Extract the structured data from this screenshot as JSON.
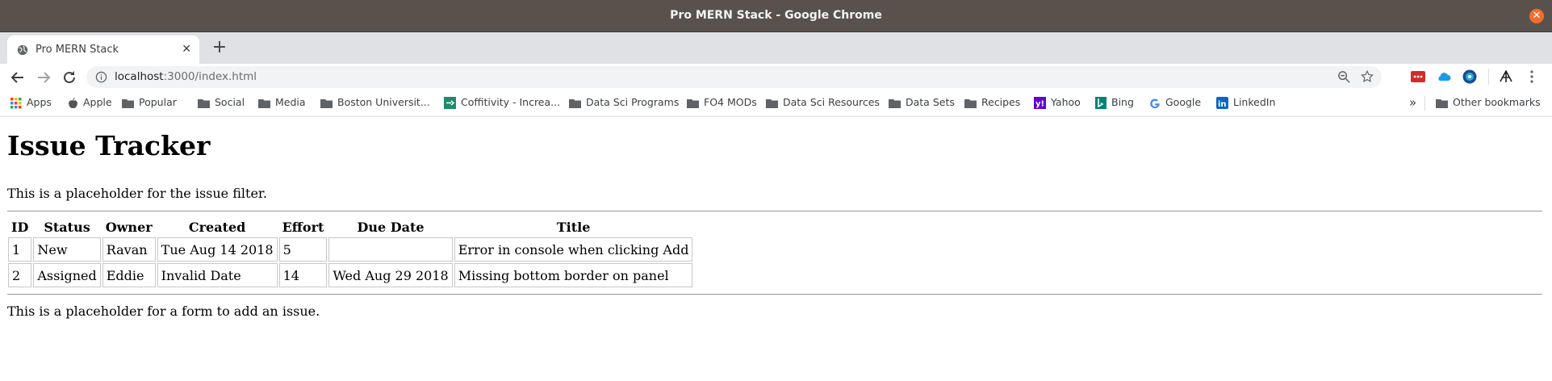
{
  "window": {
    "title": "Pro MERN Stack - Google Chrome"
  },
  "tab": {
    "label": "Pro MERN Stack"
  },
  "address": {
    "host": "localhost",
    "rest": ":3000/index.html"
  },
  "bookmarks": [
    {
      "label": "Apps",
      "icon": "apps-grid-icon"
    },
    {
      "label": "Apple",
      "icon": "apple-icon"
    },
    {
      "label": "Popular",
      "icon": "folder-icon"
    },
    {
      "label": "Social",
      "icon": "folder-icon"
    },
    {
      "label": "Media",
      "icon": "folder-icon"
    },
    {
      "label": "Boston Universit...",
      "icon": "folder-icon"
    },
    {
      "label": "Coffitivity - Increa...",
      "icon": "coffitivity-icon"
    },
    {
      "label": "Data Sci Programs",
      "icon": "folder-icon"
    },
    {
      "label": "FO4 MODs",
      "icon": "folder-icon"
    },
    {
      "label": "Data Sci Resources",
      "icon": "folder-icon"
    },
    {
      "label": "Data Sets",
      "icon": "folder-icon"
    },
    {
      "label": "Recipes",
      "icon": "folder-icon"
    },
    {
      "label": "Yahoo",
      "icon": "yahoo-icon"
    },
    {
      "label": "Bing",
      "icon": "bing-icon"
    },
    {
      "label": "Google",
      "icon": "google-icon"
    },
    {
      "label": "LinkedIn",
      "icon": "linkedin-icon"
    }
  ],
  "other_bookmarks": "Other bookmarks",
  "overflow_label": "»",
  "page": {
    "heading": "Issue Tracker",
    "filter_placeholder": "This is a placeholder for the issue filter.",
    "form_placeholder": "This is a placeholder for a form to add an issue.",
    "table": {
      "headers": [
        "ID",
        "Status",
        "Owner",
        "Created",
        "Effort",
        "Due Date",
        "Title"
      ],
      "rows": [
        [
          "1",
          "New",
          "Ravan",
          "Tue Aug 14 2018",
          "5",
          "",
          "Error in console when clicking Add"
        ],
        [
          "2",
          "Assigned",
          "Eddie",
          "Invalid Date",
          "14",
          "Wed Aug 29 2018",
          "Missing bottom border on panel"
        ]
      ]
    }
  },
  "colors": {
    "titlebar": "#59524c",
    "tabstrip": "#dfe1e5",
    "close_button": "#f46d2d",
    "omnibox": "#f1f3f4"
  }
}
